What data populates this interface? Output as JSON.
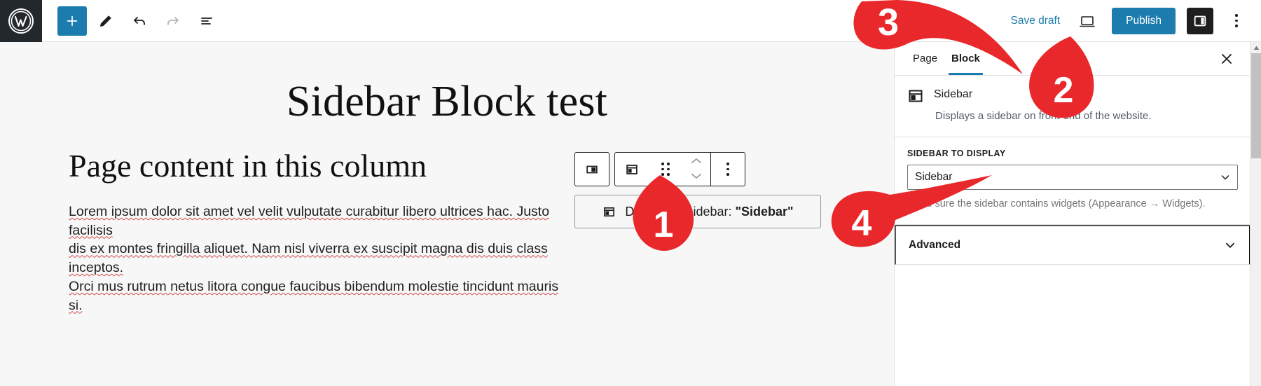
{
  "app": {
    "name": "WordPress Block Editor"
  },
  "toolbar": {
    "logo_icon": "wordpress-logo-icon",
    "add_block_label": "+",
    "add_block_icon": "plus-icon",
    "edit_icon": "pencil-icon",
    "undo_icon": "undo-icon",
    "redo_icon": "redo-icon",
    "list_view_icon": "list-view-icon",
    "save_draft_label": "Save draft",
    "preview_icon": "preview-desktop-icon",
    "publish_label": "Publish",
    "settings_toggle_icon": "settings-sidebar-icon",
    "more_options_icon": "kebab-menu-icon"
  },
  "editor": {
    "post_title": "Sidebar Block test",
    "heading": "Page content in this column",
    "paragraph_lines": [
      "Lorem ipsum dolor sit amet vel velit vulputate curabitur libero ultrices hac. Justo facilisis",
      "dis ex montes fringilla aliquet. Nam nisl viverra ex suscipit magna dis duis class inceptos.",
      "Orci mus rutrum netus litora congue faucibus bibendum molestie tincidunt mauris si."
    ],
    "block_toolbar": {
      "parent_block_icon": "columns-icon",
      "block_type_icon": "sidebar-block-icon",
      "drag_handle_icon": "drag-handle-icon",
      "move_up_icon": "chevron-up-icon",
      "move_down_icon": "chevron-down-icon",
      "options_icon": "kebab-menu-icon"
    },
    "sidebar_block": {
      "icon": "sidebar-block-icon",
      "label_prefix": "Displaying sidebar: ",
      "label_value": "\"Sidebar\""
    }
  },
  "settings_sidebar": {
    "tabs": [
      {
        "label": "Page",
        "active": false
      },
      {
        "label": "Block",
        "active": true
      }
    ],
    "close_icon": "close-icon",
    "block_info": {
      "icon": "sidebar-block-icon",
      "title": "Sidebar",
      "description": "Displays a sidebar on front-end of the website."
    },
    "sidebar_to_display": {
      "label": "SIDEBAR TO DISPLAY",
      "selected": "Sidebar",
      "options": [
        "Sidebar"
      ],
      "chevron_icon": "chevron-down-icon",
      "help": "Make sure the sidebar contains widgets (Appearance → Widgets)."
    },
    "advanced": {
      "label": "Advanced",
      "chevron_icon": "chevron-down-icon"
    }
  },
  "annotations": [
    {
      "number": "1"
    },
    {
      "number": "2"
    },
    {
      "number": "3"
    },
    {
      "number": "4"
    }
  ],
  "colors": {
    "accent": "#1b7cad",
    "marker_red": "#e8282b",
    "dark": "#1e1e1e",
    "canvas": "#f7f7f7"
  }
}
